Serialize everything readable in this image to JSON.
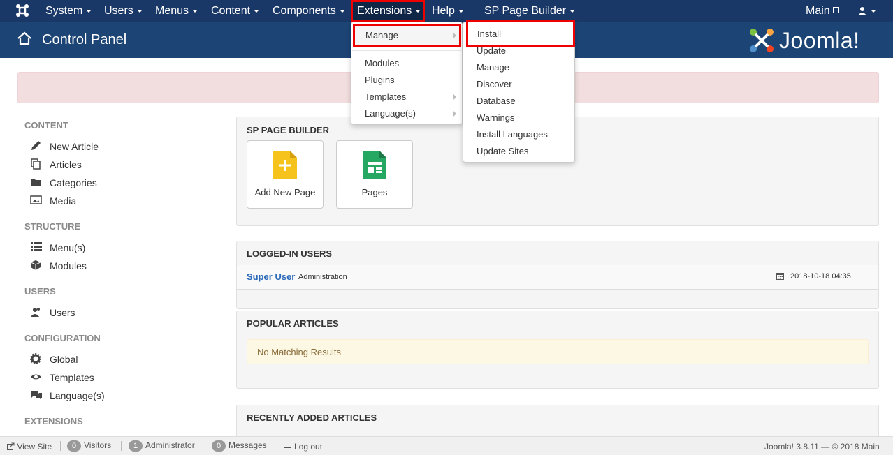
{
  "navbar": {
    "items": [
      {
        "label": "System"
      },
      {
        "label": "Users"
      },
      {
        "label": "Menus"
      },
      {
        "label": "Content"
      },
      {
        "label": "Components"
      },
      {
        "label": "Extensions"
      },
      {
        "label": "Help"
      },
      {
        "label": "SP Page Builder"
      }
    ],
    "site_link": "Main",
    "colors": {
      "navbar": "#1a3867",
      "header": "#1c4474",
      "highlight": "#e00000"
    }
  },
  "header": {
    "title": "Control Panel",
    "brand": "Joomla!"
  },
  "extensions_menu": {
    "items": [
      "Manage",
      "Modules",
      "Plugins",
      "Templates",
      "Language(s)"
    ]
  },
  "manage_submenu": {
    "items": [
      "Install",
      "Update",
      "Manage",
      "Discover",
      "Database",
      "Warnings",
      "Install Languages",
      "Update Sites"
    ]
  },
  "sidebar": {
    "sections": [
      {
        "title": "CONTENT",
        "items": [
          "New Article",
          "Articles",
          "Categories",
          "Media"
        ]
      },
      {
        "title": "STRUCTURE",
        "items": [
          "Menu(s)",
          "Modules"
        ]
      },
      {
        "title": "USERS",
        "items": [
          "Users"
        ]
      },
      {
        "title": "CONFIGURATION",
        "items": [
          "Global",
          "Templates",
          "Language(s)"
        ]
      },
      {
        "title": "EXTENSIONS",
        "items": []
      }
    ]
  },
  "main": {
    "sp_page_builder": {
      "title": "SP PAGE BUILDER",
      "tiles": [
        {
          "label": "Add New Page",
          "icon": "plus-document-icon"
        },
        {
          "label": "Pages",
          "icon": "pages-document-icon"
        }
      ]
    },
    "logged_in_users": {
      "title": "LOGGED-IN USERS",
      "user": "Super User",
      "role": "Administration",
      "date": "2018-10-18 04:35"
    },
    "popular_articles": {
      "title": "POPULAR ARTICLES",
      "empty": "No Matching Results"
    },
    "recent_articles": {
      "title": "RECENTLY ADDED ARTICLES"
    }
  },
  "statusbar": {
    "view_site": "View Site",
    "visitors_count": "0",
    "visitors_label": "Visitors",
    "admins_count": "1",
    "admins_label": "Administrator",
    "messages_count": "0",
    "messages_label": "Messages",
    "logout": "Log out",
    "version": "Joomla! 3.8.11",
    "copyright": "— © 2018 Main"
  }
}
